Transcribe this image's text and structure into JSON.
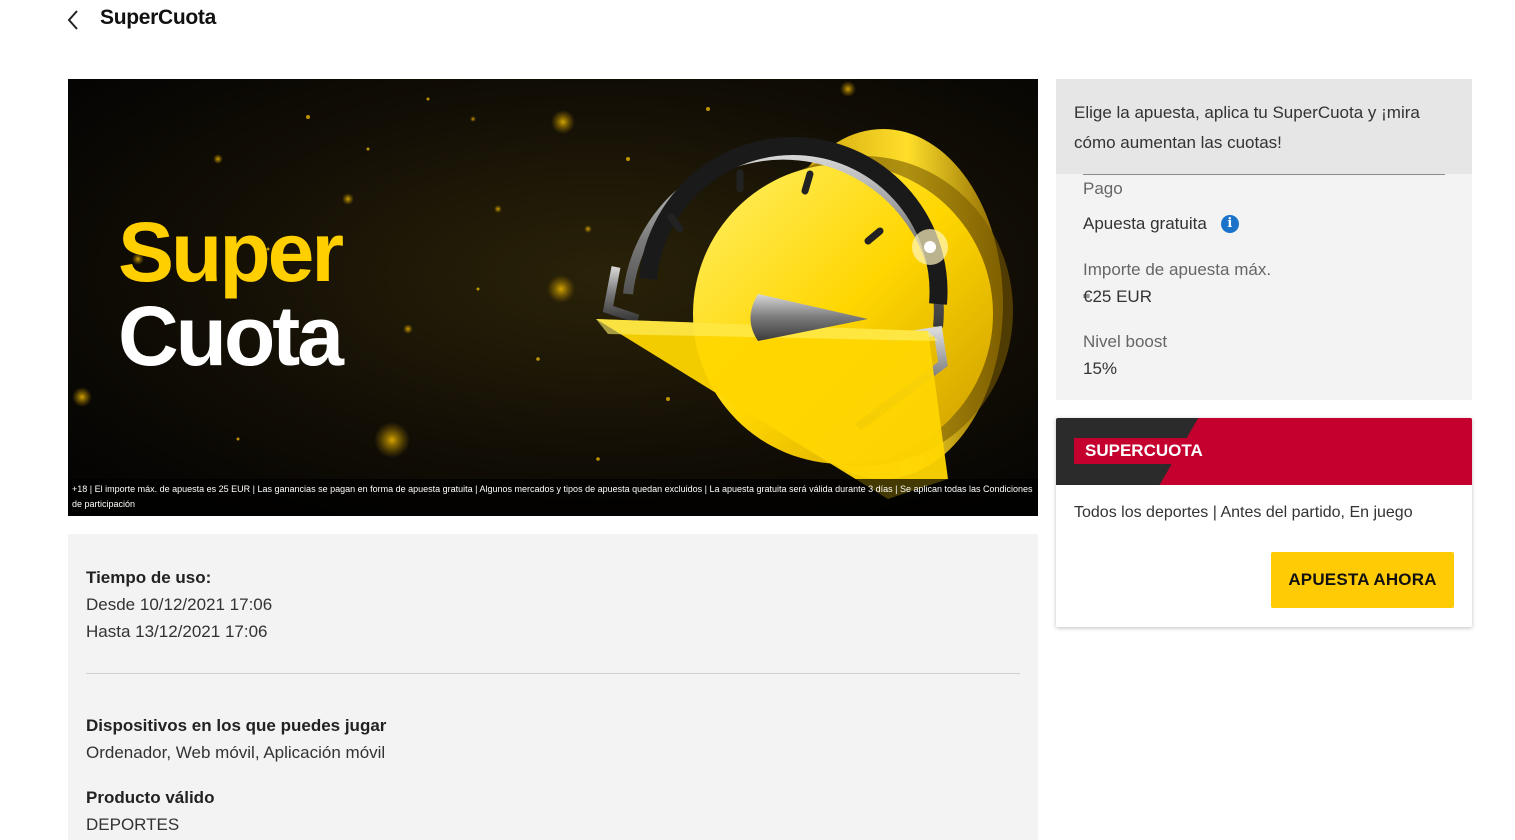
{
  "header": {
    "title": "SuperCuota",
    "back_icon": "chevron-left-icon"
  },
  "banner": {
    "logo_line1": "Super",
    "logo_line2": "Cuota",
    "disclaimer": "+18 | El importe máx. de apuesta es 25 EUR | Las ganancias se pagan en forma de apuesta gratuita | Algunos mercados y tipos de apuesta quedan excluidos | La apuesta gratuita será válida durante 3 días | Se aplican todas las Condiciones de participación",
    "colors": {
      "accent_yellow": "#ffd600",
      "background": "#0b0905"
    }
  },
  "details": {
    "usage_label": "Tiempo de uso:",
    "usage_from": "Desde 10/12/2021 17:06",
    "usage_to": "Hasta 13/12/2021 17:06",
    "devices_label": "Dispositivos en los que puedes jugar",
    "devices_value": "Ordenador, Web móvil, Aplicación móvil",
    "product_label": "Producto válido",
    "product_value": "DEPORTES"
  },
  "info": {
    "intro": "Elige la apuesta, aplica tu SuperCuota y ¡mira cómo aumentan las cuotas!",
    "payment_label": "Pago",
    "payment_value": "Apuesta gratuita",
    "payment_icon": "info-icon",
    "max_stake_label": "Importe de apuesta máx.",
    "max_stake_value": "€25 EUR",
    "boost_label": "Nivel boost",
    "boost_value": "15%"
  },
  "promo": {
    "tag": "SUPERCUOTA",
    "description": "Todos los deportes | Antes del partido, En juego",
    "cta_label": "APUESTA AHORA",
    "colors": {
      "tag_red": "#c4002f",
      "header_dark": "#2b2b2b",
      "cta_yellow": "#ffcb05"
    }
  }
}
